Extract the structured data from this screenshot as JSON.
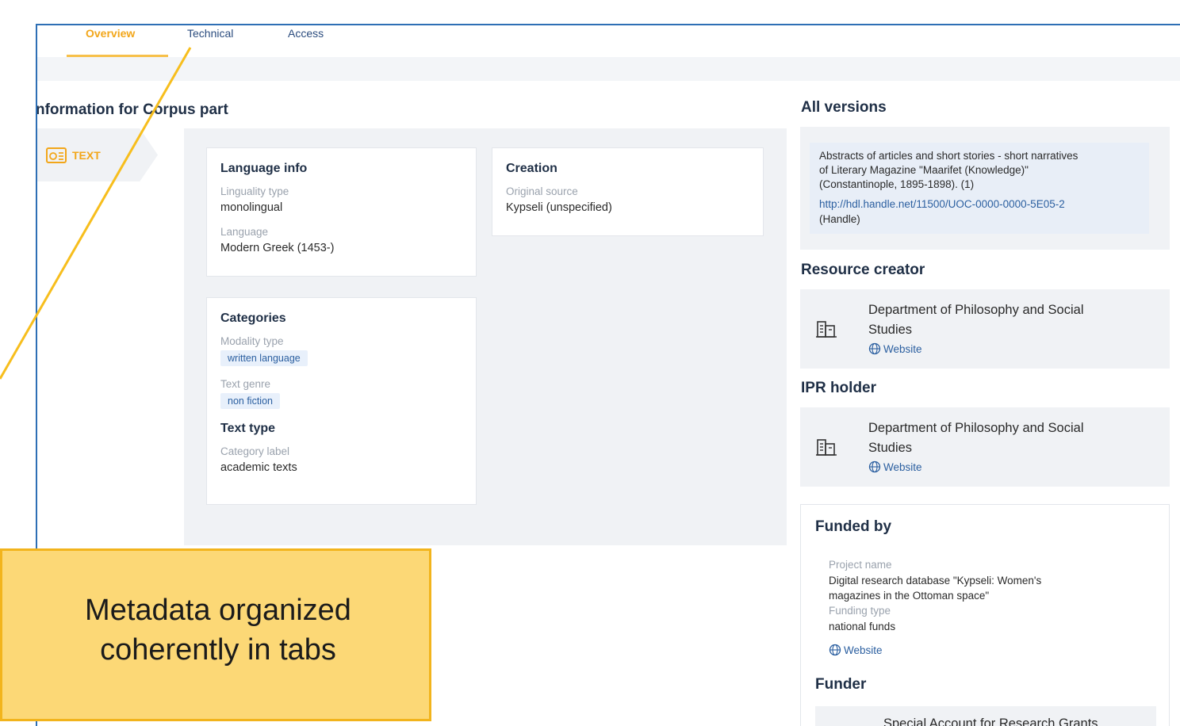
{
  "tabs": [
    {
      "label": "Overview",
      "active": true
    },
    {
      "label": "Technical",
      "active": false
    },
    {
      "label": "Access",
      "active": false
    }
  ],
  "section_title": "nformation for Corpus part",
  "side_tab": {
    "label": "TEXT",
    "icon": "text-document-icon"
  },
  "language_info": {
    "title": "Language info",
    "linguality_label": "Linguality type",
    "linguality_value": "monolingual",
    "language_label": "Language",
    "language_value": "Modern Greek (1453-)"
  },
  "creation": {
    "title": "Creation",
    "source_label": "Original source",
    "source_value": "Kypseli (unspecified)"
  },
  "categories": {
    "title": "Categories",
    "modality_label": "Modality type",
    "modality_value": "written language",
    "genre_label": "Text genre",
    "genre_value": "non fiction",
    "text_type_title": "Text type",
    "category_label": "Category label",
    "category_value": "academic texts"
  },
  "all_versions": {
    "title": "All versions",
    "line1": "Abstracts of articles and short stories - short narratives",
    "line2": "of Literary Magazine \"Maarifet (Knowledge)\"",
    "line3": "(Constantinople, 1895-1898). (1)",
    "link": "http://hdl.handle.net/11500/UOC-0000-0000-5E05-2",
    "link_type": "(Handle)"
  },
  "resource_creator": {
    "title": "Resource creator",
    "name_line1": "Department of Philosophy and Social",
    "name_line2": "Studies",
    "website": "Website"
  },
  "ipr_holder": {
    "title": "IPR holder",
    "name_line1": "Department of Philosophy and Social",
    "name_line2": "Studies",
    "website": "Website"
  },
  "funded_by": {
    "title": "Funded by",
    "project_label": "Project name",
    "project_line1": "Digital research database \"Kypseli: Women's",
    "project_line2": "magazines in the Ottoman space\"",
    "funding_type_label": "Funding type",
    "funding_type_value": "national funds",
    "website": "Website",
    "funder_title": "Funder",
    "funder_name": "Special Account for Research Grants"
  },
  "callout": {
    "line1": "Metadata organized",
    "line2": "coherently in tabs"
  },
  "colors": {
    "accent": "#f2a619",
    "frame": "#2e6fb5",
    "link": "#2b5fa0",
    "callout_bg": "#fcd876"
  }
}
